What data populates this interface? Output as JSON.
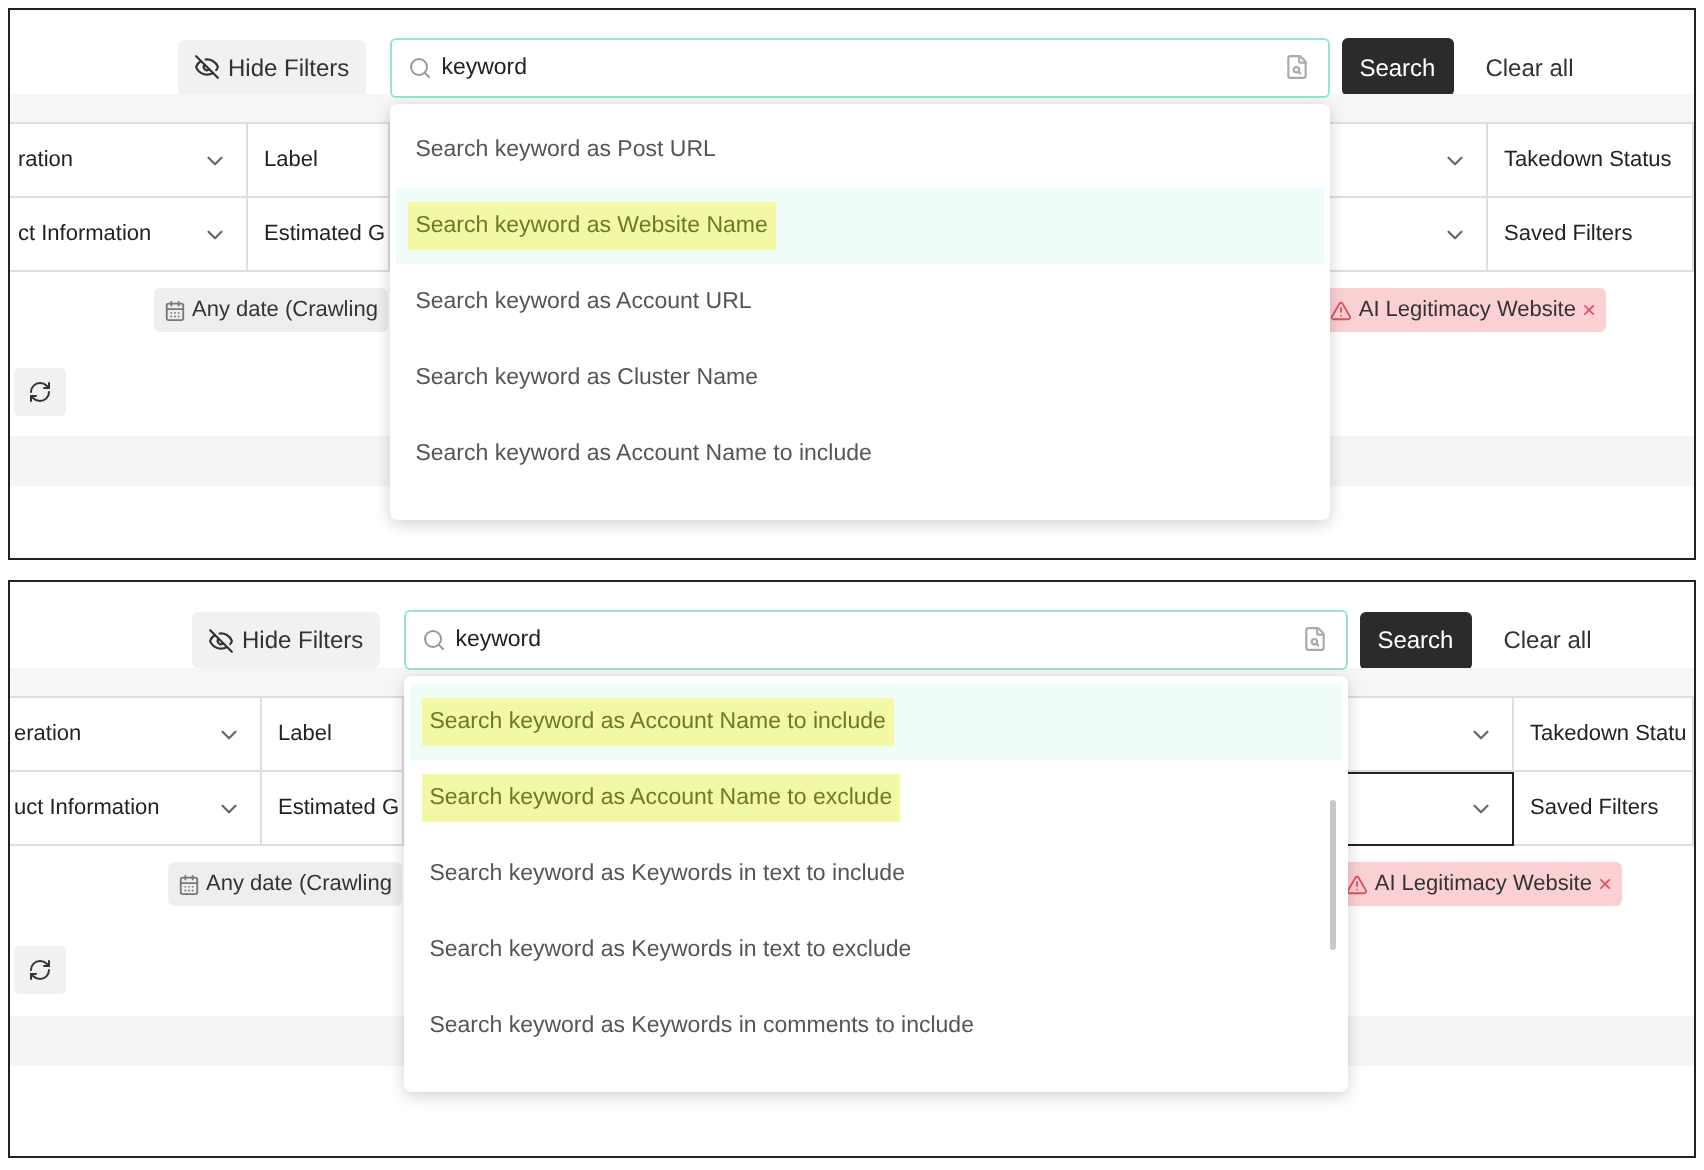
{
  "panels": [
    {
      "hide_filters": "Hide Filters",
      "search": {
        "value": "keyword"
      },
      "search_button": "Search",
      "clear_all": "Clear all",
      "filter_rows": [
        [
          {
            "label": "ration",
            "dropdown": true,
            "focused": false
          },
          {
            "label": "Label",
            "dropdown": false,
            "focused": false
          },
          {
            "dropdown": true,
            "focused": false
          },
          {
            "label": "Takedown Status",
            "dropdown": false,
            "focused": false
          }
        ],
        [
          {
            "label": "ct Information",
            "dropdown": true,
            "focused": false
          },
          {
            "label": "Estimated G",
            "dropdown": false,
            "focused": false
          },
          {
            "dropdown": true,
            "focused": false
          },
          {
            "label": "Saved Filters",
            "dropdown": false,
            "focused": false
          }
        ]
      ],
      "tags": [
        {
          "label": "Any date (Crawling",
          "kind": "date"
        },
        {
          "label": "AI Legitimacy Website",
          "kind": "alert",
          "removable": true,
          "remove": "×"
        }
      ],
      "suggestions": [
        {
          "label": "Search keyword as Post URL",
          "selected": false,
          "highlighted": false
        },
        {
          "label": "Search keyword as Website Name",
          "selected": true,
          "highlighted": true
        },
        {
          "label": "Search keyword as Account URL",
          "selected": false,
          "highlighted": false
        },
        {
          "label": "Search keyword as Cluster Name",
          "selected": false,
          "highlighted": false
        },
        {
          "label": "Search keyword as Account Name to include",
          "selected": false,
          "highlighted": false
        }
      ],
      "scrollable": false
    },
    {
      "hide_filters": "Hide Filters",
      "search": {
        "value": "keyword"
      },
      "search_button": "Search",
      "clear_all": "Clear all",
      "filter_rows": [
        [
          {
            "label": "eration",
            "dropdown": true,
            "focused": false
          },
          {
            "label": "Label",
            "dropdown": false,
            "focused": false
          },
          {
            "dropdown": true,
            "focused": false
          },
          {
            "label": "Takedown Statu",
            "dropdown": false,
            "focused": false
          }
        ],
        [
          {
            "label": "uct Information",
            "dropdown": true,
            "focused": false
          },
          {
            "label": "Estimated G",
            "dropdown": false,
            "focused": false
          },
          {
            "dropdown": true,
            "focused": true
          },
          {
            "label": "Saved Filters",
            "dropdown": false,
            "focused": false
          }
        ]
      ],
      "tags": [
        {
          "label": "Any date (Crawling",
          "kind": "date"
        },
        {
          "label": "AI Legitimacy Website",
          "kind": "alert",
          "removable": true,
          "remove": "×"
        }
      ],
      "suggestions": [
        {
          "label": "Search keyword as Account Name to include",
          "selected": true,
          "highlighted": true
        },
        {
          "label": "Search keyword as Account Name to exclude",
          "selected": false,
          "highlighted": true
        },
        {
          "label": "Search keyword as Keywords in text to include",
          "selected": false,
          "highlighted": false
        },
        {
          "label": "Search keyword as Keywords in text to exclude",
          "selected": false,
          "highlighted": false
        },
        {
          "label": "Search keyword as Keywords in comments to include",
          "selected": false,
          "highlighted": false
        }
      ],
      "scrollable": true
    }
  ]
}
